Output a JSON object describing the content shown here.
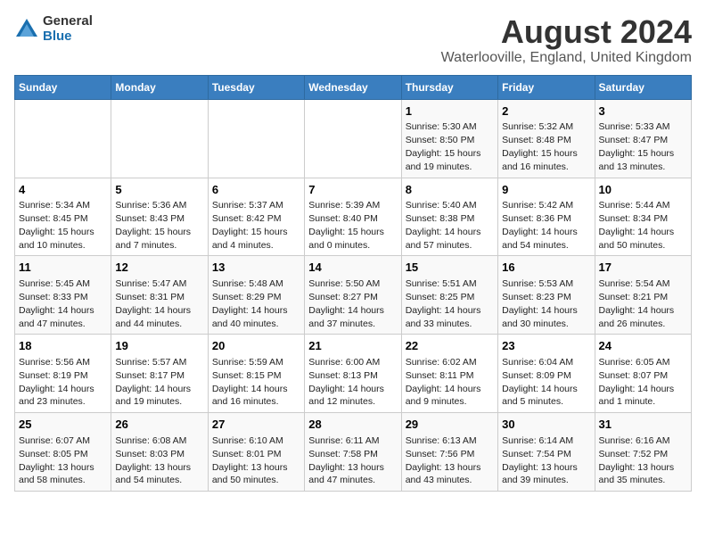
{
  "logo": {
    "general": "General",
    "blue": "Blue"
  },
  "title": "August 2024",
  "subtitle": "Waterlooville, England, United Kingdom",
  "headers": [
    "Sunday",
    "Monday",
    "Tuesday",
    "Wednesday",
    "Thursday",
    "Friday",
    "Saturday"
  ],
  "weeks": [
    [
      {
        "day": "",
        "info": ""
      },
      {
        "day": "",
        "info": ""
      },
      {
        "day": "",
        "info": ""
      },
      {
        "day": "",
        "info": ""
      },
      {
        "day": "1",
        "info": "Sunrise: 5:30 AM\nSunset: 8:50 PM\nDaylight: 15 hours\nand 19 minutes."
      },
      {
        "day": "2",
        "info": "Sunrise: 5:32 AM\nSunset: 8:48 PM\nDaylight: 15 hours\nand 16 minutes."
      },
      {
        "day": "3",
        "info": "Sunrise: 5:33 AM\nSunset: 8:47 PM\nDaylight: 15 hours\nand 13 minutes."
      }
    ],
    [
      {
        "day": "4",
        "info": "Sunrise: 5:34 AM\nSunset: 8:45 PM\nDaylight: 15 hours\nand 10 minutes."
      },
      {
        "day": "5",
        "info": "Sunrise: 5:36 AM\nSunset: 8:43 PM\nDaylight: 15 hours\nand 7 minutes."
      },
      {
        "day": "6",
        "info": "Sunrise: 5:37 AM\nSunset: 8:42 PM\nDaylight: 15 hours\nand 4 minutes."
      },
      {
        "day": "7",
        "info": "Sunrise: 5:39 AM\nSunset: 8:40 PM\nDaylight: 15 hours\nand 0 minutes."
      },
      {
        "day": "8",
        "info": "Sunrise: 5:40 AM\nSunset: 8:38 PM\nDaylight: 14 hours\nand 57 minutes."
      },
      {
        "day": "9",
        "info": "Sunrise: 5:42 AM\nSunset: 8:36 PM\nDaylight: 14 hours\nand 54 minutes."
      },
      {
        "day": "10",
        "info": "Sunrise: 5:44 AM\nSunset: 8:34 PM\nDaylight: 14 hours\nand 50 minutes."
      }
    ],
    [
      {
        "day": "11",
        "info": "Sunrise: 5:45 AM\nSunset: 8:33 PM\nDaylight: 14 hours\nand 47 minutes."
      },
      {
        "day": "12",
        "info": "Sunrise: 5:47 AM\nSunset: 8:31 PM\nDaylight: 14 hours\nand 44 minutes."
      },
      {
        "day": "13",
        "info": "Sunrise: 5:48 AM\nSunset: 8:29 PM\nDaylight: 14 hours\nand 40 minutes."
      },
      {
        "day": "14",
        "info": "Sunrise: 5:50 AM\nSunset: 8:27 PM\nDaylight: 14 hours\nand 37 minutes."
      },
      {
        "day": "15",
        "info": "Sunrise: 5:51 AM\nSunset: 8:25 PM\nDaylight: 14 hours\nand 33 minutes."
      },
      {
        "day": "16",
        "info": "Sunrise: 5:53 AM\nSunset: 8:23 PM\nDaylight: 14 hours\nand 30 minutes."
      },
      {
        "day": "17",
        "info": "Sunrise: 5:54 AM\nSunset: 8:21 PM\nDaylight: 14 hours\nand 26 minutes."
      }
    ],
    [
      {
        "day": "18",
        "info": "Sunrise: 5:56 AM\nSunset: 8:19 PM\nDaylight: 14 hours\nand 23 minutes."
      },
      {
        "day": "19",
        "info": "Sunrise: 5:57 AM\nSunset: 8:17 PM\nDaylight: 14 hours\nand 19 minutes."
      },
      {
        "day": "20",
        "info": "Sunrise: 5:59 AM\nSunset: 8:15 PM\nDaylight: 14 hours\nand 16 minutes."
      },
      {
        "day": "21",
        "info": "Sunrise: 6:00 AM\nSunset: 8:13 PM\nDaylight: 14 hours\nand 12 minutes."
      },
      {
        "day": "22",
        "info": "Sunrise: 6:02 AM\nSunset: 8:11 PM\nDaylight: 14 hours\nand 9 minutes."
      },
      {
        "day": "23",
        "info": "Sunrise: 6:04 AM\nSunset: 8:09 PM\nDaylight: 14 hours\nand 5 minutes."
      },
      {
        "day": "24",
        "info": "Sunrise: 6:05 AM\nSunset: 8:07 PM\nDaylight: 14 hours\nand 1 minute."
      }
    ],
    [
      {
        "day": "25",
        "info": "Sunrise: 6:07 AM\nSunset: 8:05 PM\nDaylight: 13 hours\nand 58 minutes."
      },
      {
        "day": "26",
        "info": "Sunrise: 6:08 AM\nSunset: 8:03 PM\nDaylight: 13 hours\nand 54 minutes."
      },
      {
        "day": "27",
        "info": "Sunrise: 6:10 AM\nSunset: 8:01 PM\nDaylight: 13 hours\nand 50 minutes."
      },
      {
        "day": "28",
        "info": "Sunrise: 6:11 AM\nSunset: 7:58 PM\nDaylight: 13 hours\nand 47 minutes."
      },
      {
        "day": "29",
        "info": "Sunrise: 6:13 AM\nSunset: 7:56 PM\nDaylight: 13 hours\nand 43 minutes."
      },
      {
        "day": "30",
        "info": "Sunrise: 6:14 AM\nSunset: 7:54 PM\nDaylight: 13 hours\nand 39 minutes."
      },
      {
        "day": "31",
        "info": "Sunrise: 6:16 AM\nSunset: 7:52 PM\nDaylight: 13 hours\nand 35 minutes."
      }
    ]
  ]
}
